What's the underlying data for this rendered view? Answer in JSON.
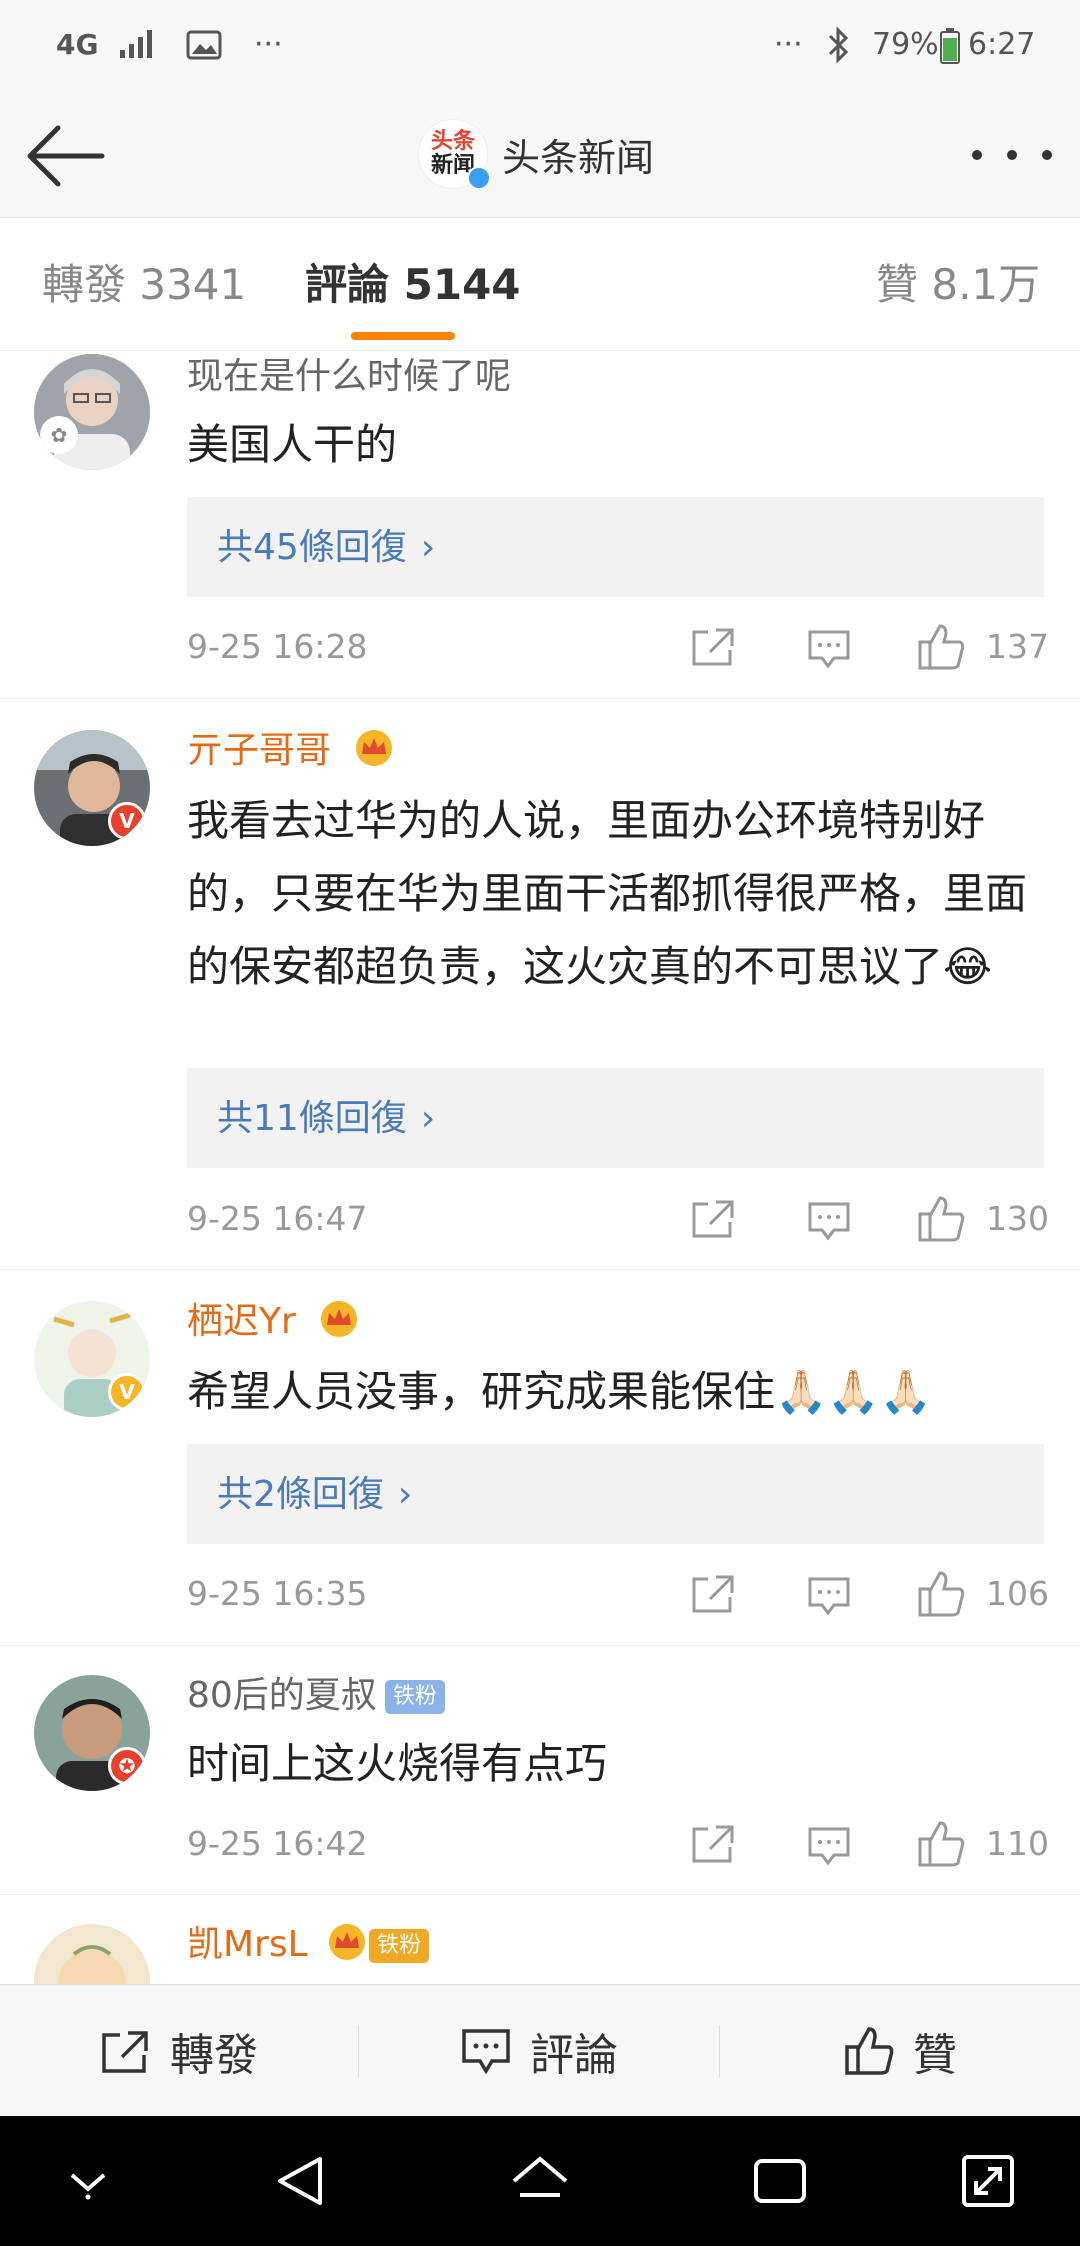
{
  "status_bar": {
    "network": "4G",
    "more_left": "···",
    "more_right": "···",
    "battery": "79%",
    "time": "6:27"
  },
  "nav": {
    "account_name": "头条新闻",
    "logo_line1": "头条",
    "logo_line2": "新闻"
  },
  "tabs": [
    {
      "label": "轉發 3341"
    },
    {
      "label": "評論 5144"
    },
    {
      "label": "贊 8.1万"
    }
  ],
  "comments": [
    {
      "username": "现在是什么时候了呢",
      "text": "美国人干的",
      "replies": "共45條回復",
      "time": "9-25 16:28",
      "likes": "137"
    },
    {
      "username": "亓子哥哥",
      "text": "我看去过华为的人说，里面办公环境特别好的，只要在华为里面干活都抓得很严格，里面的保安都超负责，这火灾真的不可思议了😂",
      "replies": "共11條回復",
      "time": "9-25 16:47",
      "likes": "130"
    },
    {
      "username": "栖迟Yr",
      "text": "希望人员没事，研究成果能保住🙏🏻🙏🏻🙏🏻",
      "replies": "共2條回復",
      "time": "9-25 16:35",
      "likes": "106"
    },
    {
      "username": "80后的夏叔",
      "fan_badge": "铁粉",
      "text": "时间上这火烧得有点巧",
      "time": "9-25 16:42",
      "likes": "110"
    },
    {
      "username": "凯MrsL",
      "fan_badge": "铁粉"
    }
  ],
  "bottom_bar": {
    "repost": "轉發",
    "comment": "評論",
    "like": "贊"
  },
  "colors": {
    "accent": "#ff8200",
    "vip_name": "#e66a13",
    "reply_link": "#4a7ab8"
  }
}
